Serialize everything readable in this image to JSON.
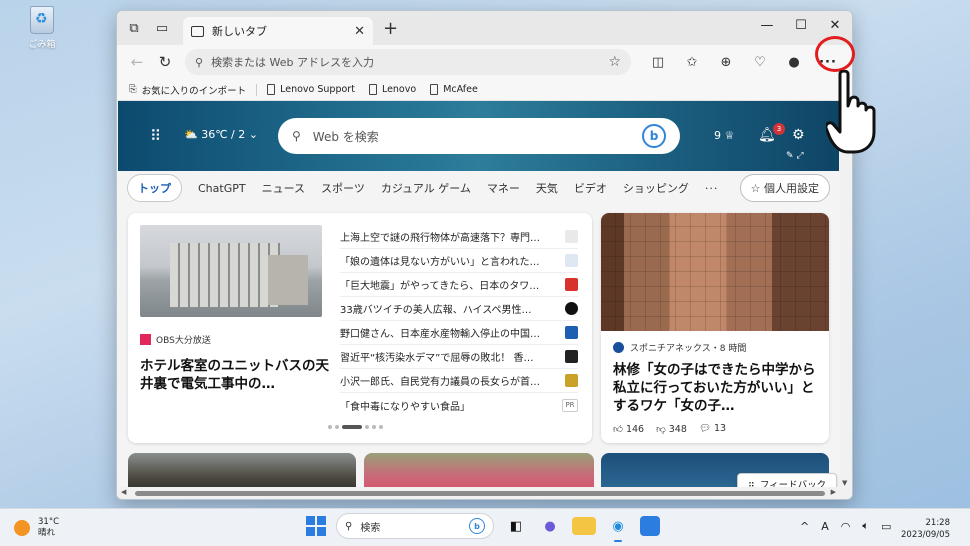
{
  "desktop": {
    "recycle_label": "ごみ箱"
  },
  "browser": {
    "tab_title": "新しいタブ",
    "address_placeholder": "検索または Web アドレスを入力",
    "favorites": [
      "お気に入りのインポート",
      "Lenovo Support",
      "Lenovo",
      "McAfee"
    ]
  },
  "newtab": {
    "weather": "36℃ / 2",
    "search_placeholder": "Web を検索",
    "bing_label": "b",
    "rewards_points": "9",
    "notifications_count": "3",
    "categories": [
      "トップ",
      "ChatGPT",
      "ニュース",
      "スポーツ",
      "カジュアル ゲーム",
      "マネー",
      "天気",
      "ビデオ",
      "ショッピング"
    ],
    "more_label": "···",
    "personal_settings": "個人用設定",
    "main_card": {
      "source": "OBS大分放送",
      "headline": "ホテル客室のユニットバスの天井裏で電気工事中の…",
      "news": [
        {
          "title": "上海上空で謎の飛行物体が高速落下？専門…",
          "color": "#e9e9e9"
        },
        {
          "title": "「娘の遺体は見ない方がいい」と言われた…",
          "color": "#dfe7f3"
        },
        {
          "title": "「巨大地震」がやってきたら、日本のタワ…",
          "color": "#d8322d"
        },
        {
          "title": "33歳バツイチの美人広報、ハイスペ男性…",
          "color": "#111111"
        },
        {
          "title": "野口健さん、日本産水産物輸入停止の中国…",
          "color": "#1d5fb0"
        },
        {
          "title": "習近平“核汚染水デマ”で屈辱の敗北！ 香…",
          "color": "#222222"
        },
        {
          "title": "小沢一郎氏、自民党有力議員の長女らが首…",
          "color": "#c9a227"
        },
        {
          "title": "「食中毒になりやすい食品」",
          "color": "#ffffff",
          "tag": "PR"
        }
      ]
    },
    "right_card": {
      "source": "スポニチアネックス・8 時間",
      "headline": "林修「女の子はできたら中学から私立に行っておいた方がいい」とするワケ「女の子…",
      "likes": "146",
      "dislikes": "348",
      "comments": "13"
    },
    "feedback_label": "フィードバック"
  },
  "taskbar": {
    "temperature": "31°C",
    "condition": "晴れ",
    "search_label": "検索",
    "ime_label": "A",
    "time": "21:28",
    "date": "2023/09/05"
  },
  "colors": {
    "accent": "#2b7de0",
    "annotation_red": "#e21d1d",
    "notification_badge": "#d13438"
  }
}
